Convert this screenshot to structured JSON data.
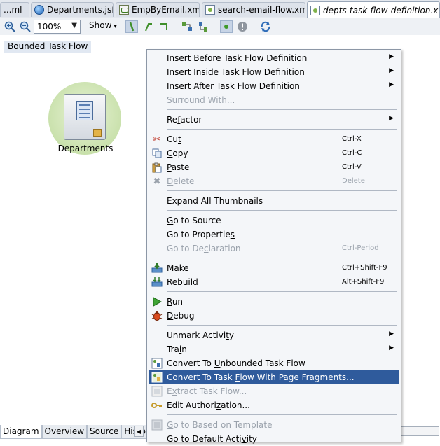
{
  "tabs": [
    {
      "label": "...ml",
      "icon": "xml-file-icon"
    },
    {
      "label": "Departments.jsf",
      "icon": "jsf-globe-icon"
    },
    {
      "label": "EmpByEmail.xml",
      "icon": "xml-file-icon"
    },
    {
      "label": "search-email-flow.xml",
      "icon": "task-flow-icon"
    },
    {
      "label": "depts-task-flow-definition.xml",
      "icon": "task-flow-icon"
    }
  ],
  "toolbar": {
    "zoom_value": "100%",
    "show_label": "Show"
  },
  "breadcrumb": "Bounded Task Flow",
  "node": {
    "label": "Departments"
  },
  "bottom_tabs": [
    "Diagram",
    "Overview",
    "Source",
    "History"
  ],
  "menu": {
    "items": [
      {
        "pre": "Insert Before Task Flow Definition",
        "u": "",
        "post": "",
        "shortcut": "",
        "submenu": true,
        "disabled": false,
        "icon": ""
      },
      {
        "pre": "Insert Inside Ta",
        "u": "s",
        "post": "k Flow Definition",
        "shortcut": "",
        "submenu": true,
        "disabled": false,
        "icon": ""
      },
      {
        "pre": "Insert ",
        "u": "A",
        "post": "fter Task Flow Definition",
        "shortcut": "",
        "submenu": true,
        "disabled": false,
        "icon": ""
      },
      {
        "pre": "Surround ",
        "u": "W",
        "post": "ith...",
        "shortcut": "",
        "submenu": false,
        "disabled": true,
        "icon": ""
      },
      {
        "pre": "Re",
        "u": "f",
        "post": "actor",
        "shortcut": "",
        "submenu": true,
        "disabled": false,
        "icon": ""
      },
      {
        "pre": "Cu",
        "u": "t",
        "post": "",
        "shortcut": "Ctrl-X",
        "submenu": false,
        "disabled": false,
        "icon": "scissors-icon"
      },
      {
        "pre": "",
        "u": "C",
        "post": "opy",
        "shortcut": "Ctrl-C",
        "submenu": false,
        "disabled": false,
        "icon": "copy-icon"
      },
      {
        "pre": "",
        "u": "P",
        "post": "aste",
        "shortcut": "Ctrl-V",
        "submenu": false,
        "disabled": false,
        "icon": "paste-icon"
      },
      {
        "pre": "",
        "u": "D",
        "post": "elete",
        "shortcut": "Delete",
        "submenu": false,
        "disabled": true,
        "icon": "delete-x-icon"
      },
      {
        "pre": "Expand All Thumbnails",
        "u": "",
        "post": "",
        "shortcut": "",
        "submenu": false,
        "disabled": false,
        "icon": ""
      },
      {
        "pre": "",
        "u": "G",
        "post": "o to Source",
        "shortcut": "",
        "submenu": false,
        "disabled": false,
        "icon": ""
      },
      {
        "pre": "Go to Propertie",
        "u": "s",
        "post": "",
        "shortcut": "",
        "submenu": false,
        "disabled": false,
        "icon": ""
      },
      {
        "pre": "Go to De",
        "u": "c",
        "post": "laration",
        "shortcut": "Ctrl-Period",
        "submenu": false,
        "disabled": true,
        "icon": ""
      },
      {
        "pre": "",
        "u": "M",
        "post": "ake",
        "shortcut": "Ctrl+Shift-F9",
        "submenu": false,
        "disabled": false,
        "icon": "make-icon"
      },
      {
        "pre": "Reb",
        "u": "u",
        "post": "ild",
        "shortcut": "Alt+Shift-F9",
        "submenu": false,
        "disabled": false,
        "icon": "rebuild-icon"
      },
      {
        "pre": "",
        "u": "R",
        "post": "un",
        "shortcut": "",
        "submenu": false,
        "disabled": false,
        "icon": "run-icon"
      },
      {
        "pre": "",
        "u": "D",
        "post": "ebug",
        "shortcut": "",
        "submenu": false,
        "disabled": false,
        "icon": "debug-bug-icon"
      },
      {
        "pre": "Unmark Activi",
        "u": "t",
        "post": "y",
        "shortcut": "",
        "submenu": true,
        "disabled": false,
        "icon": ""
      },
      {
        "pre": "Tra",
        "u": "i",
        "post": "n",
        "shortcut": "",
        "submenu": true,
        "disabled": false,
        "icon": ""
      },
      {
        "pre": "Convert To ",
        "u": "U",
        "post": "nbounded Task Flow",
        "shortcut": "",
        "submenu": false,
        "disabled": false,
        "icon": "convert-flow-icon"
      },
      {
        "pre": "Convert To Task ",
        "u": "F",
        "post": "low With Page Fragments...",
        "shortcut": "",
        "submenu": false,
        "disabled": false,
        "icon": "convert-fragments-icon"
      },
      {
        "pre": "E",
        "u": "x",
        "post": "tract Task Flow...",
        "shortcut": "",
        "submenu": false,
        "disabled": true,
        "icon": "extract-flow-icon"
      },
      {
        "pre": "Edit Authori",
        "u": "z",
        "post": "ation...",
        "shortcut": "",
        "submenu": false,
        "disabled": false,
        "icon": "key-icon"
      },
      {
        "pre": "",
        "u": "G",
        "post": "o to Based on Template",
        "shortcut": "",
        "submenu": false,
        "disabled": true,
        "icon": "template-icon"
      },
      {
        "pre": "Go to Default Acti",
        "u": "v",
        "post": "ity",
        "shortcut": "",
        "submenu": false,
        "disabled": false,
        "icon": ""
      }
    ]
  },
  "colors": {
    "highlight": "#2f5b9c",
    "menu_bg": "#f4f6f9",
    "disabled_text": "#9aa2ac"
  }
}
